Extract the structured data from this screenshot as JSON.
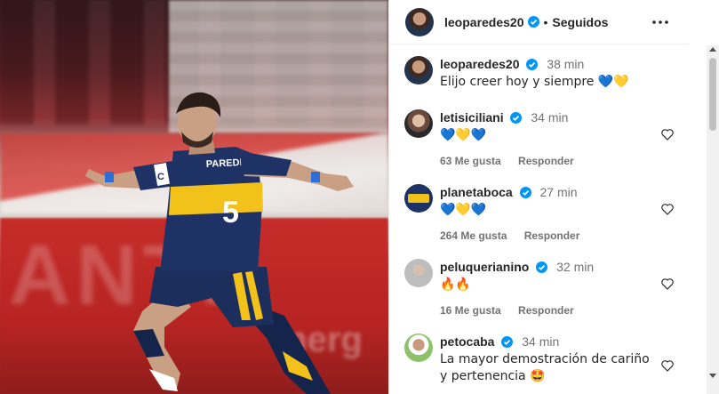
{
  "post": {
    "author": "leoparedes20",
    "separator": "•",
    "follow_status": "Seguidos",
    "more_icon": "more-horizontal-icon"
  },
  "colors": {
    "verified": "#0095f6",
    "muted": "#737373",
    "text": "#262626",
    "boca_blue": "#1e4fa3",
    "boca_yellow": "#f2c21b"
  },
  "comments": [
    {
      "username": "leoparedes20",
      "time": "38 min",
      "text": "Elijo creer hoy y siempre 💙💛",
      "likes": "",
      "reply": "",
      "has_heart": false
    },
    {
      "username": "letisiciliani",
      "time": "34 min",
      "text": "💙💛💙",
      "likes": "63 Me gusta",
      "reply": "Responder",
      "has_heart": true
    },
    {
      "username": "planetaboca",
      "time": "27 min",
      "text": "💙💛💙",
      "likes": "264 Me gusta",
      "reply": "Responder",
      "has_heart": true
    },
    {
      "username": "peluquerianino",
      "time": "32 min",
      "text": "🔥🔥",
      "likes": "16 Me gusta",
      "reply": "Responder",
      "has_heart": true
    },
    {
      "username": "petocaba",
      "time": "34 min",
      "text": "La mayor demostración de cariño y pertenencia 🤩",
      "likes": "",
      "reply": "",
      "has_heart": true
    }
  ],
  "photo": {
    "jersey_name": "PAREDES",
    "jersey_number": "5",
    "captain_band": "C",
    "board_text": "ANTI",
    "board_text2": "merg"
  }
}
